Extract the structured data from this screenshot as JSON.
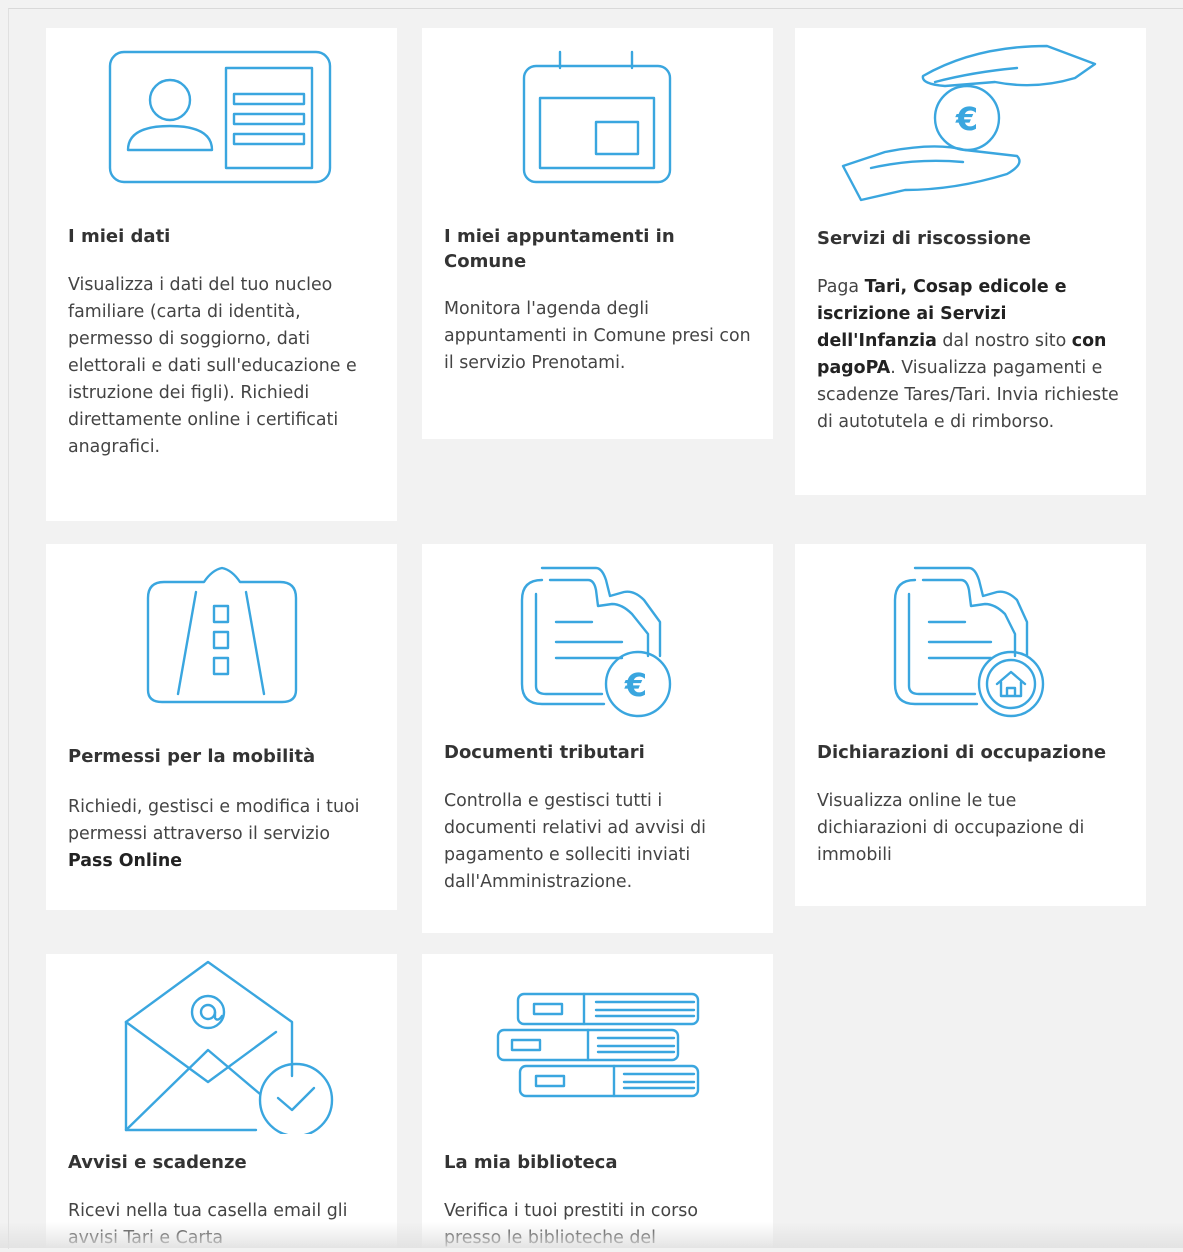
{
  "cards": [
    {
      "icon": "id-card-icon",
      "title": "I miei dati",
      "description": "Visualizza i dati del tuo nucleo familiare (carta di identità, permesso di soggiorno, dati elettorali e dati sull'educazione e istruzione dei figli). Richiedi direttamente online i certificati anagrafici."
    },
    {
      "icon": "calendar-icon",
      "title": "I miei appuntamenti in Comune",
      "description": "Monitora l'agenda degli appuntamenti in Comune presi con il servizio Prenotami."
    },
    {
      "icon": "hands-euro-icon",
      "title": "Servizi di riscossione",
      "description_parts": {
        "p1": "Paga ",
        "b1": "Tari, Cosap edicole e iscrizione ai Servizi dell'Infanzia",
        "p2": " dal nostro sito ",
        "b2": "con pagoPA",
        "p3": ". Visualizza pagamenti e scadenze Tares/Tari. Invia richieste di autotutela e di rimborso."
      }
    },
    {
      "icon": "road-icon",
      "title": "Permessi per la mobilità",
      "description_parts": {
        "p1": "Richiedi, gestisci e modifica i tuoi permessi attraverso il servizio ",
        "b1": "Pass Online"
      }
    },
    {
      "icon": "document-euro-icon",
      "title": "Documenti tributari",
      "description": "Controlla e gestisci tutti i documenti relativi ad avvisi di pagamento e solleciti inviati dall'Amministrazione."
    },
    {
      "icon": "document-house-icon",
      "title": "Dichiarazioni di occupazione",
      "description": "Visualizza online le tue dichiarazioni di occupazione di immobili"
    },
    {
      "icon": "envelope-check-icon",
      "title": "Avvisi e scadenze",
      "description": "Ricevi nella tua casella email gli avvisi Tari e Carta"
    },
    {
      "icon": "books-icon",
      "title": "La mia biblioteca",
      "description": "Verifica i tuoi prestiti in corso presso le biblioteche del"
    }
  ],
  "colors": {
    "accent": "#3aa6df",
    "card_background": "#ffffff",
    "page_background": "#f2f2f2",
    "text": "#333333"
  }
}
